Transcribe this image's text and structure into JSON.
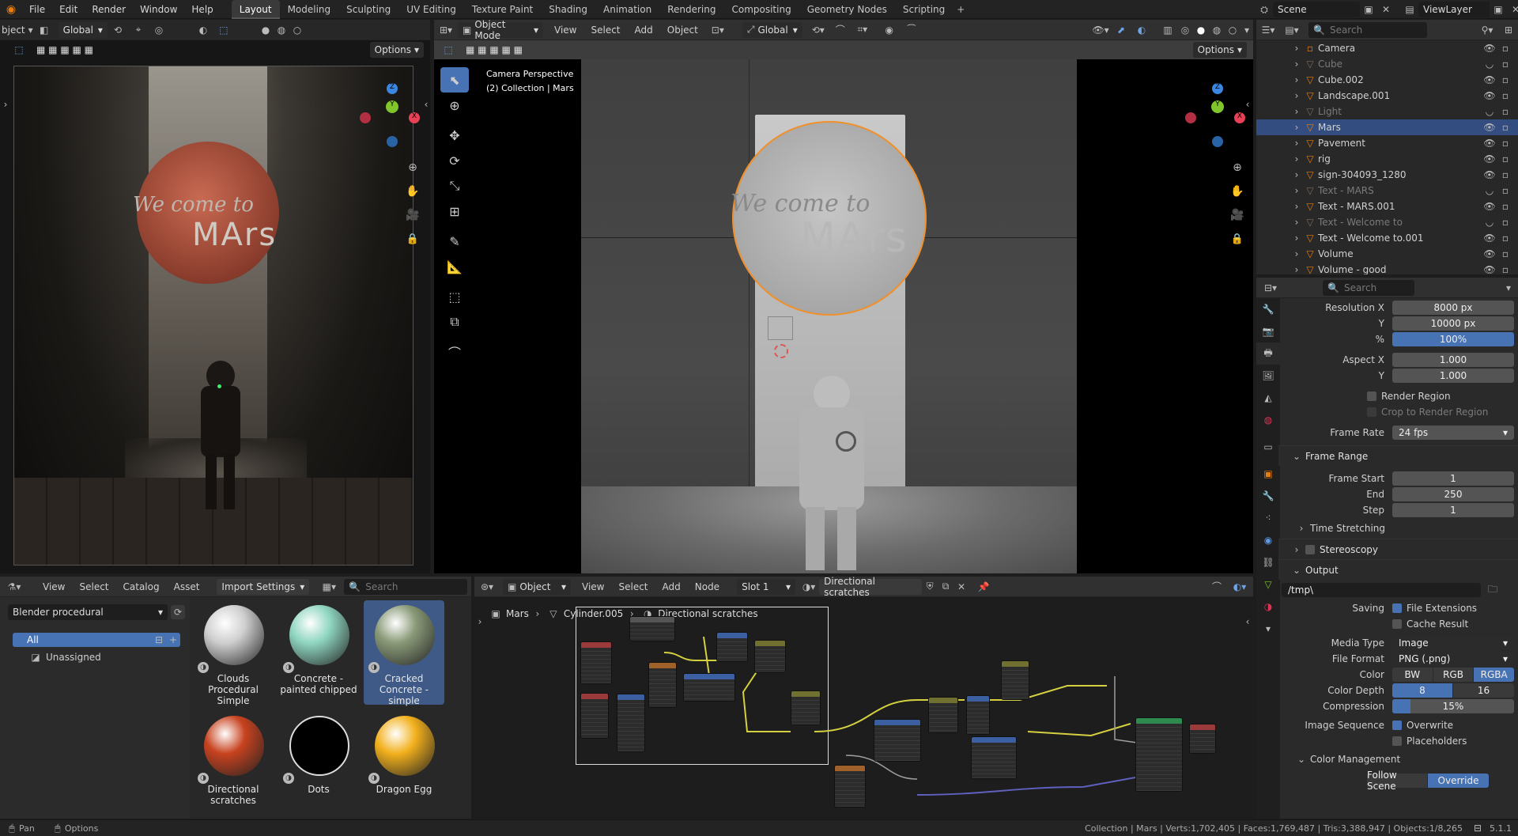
{
  "topbar": {
    "menus": [
      "File",
      "Edit",
      "Render",
      "Window",
      "Help"
    ],
    "workspaces": [
      "Layout",
      "Modeling",
      "Sculpting",
      "UV Editing",
      "Texture Paint",
      "Shading",
      "Animation",
      "Rendering",
      "Compositing",
      "Geometry Nodes",
      "Scripting"
    ],
    "active_workspace": "Layout",
    "scene": "Scene",
    "view_layer": "ViewLayer"
  },
  "left_viewport": {
    "mode_label": "bject",
    "transform": "Global",
    "options": "Options",
    "render_text_1": "We come to",
    "render_text_2": "MArs"
  },
  "main_viewport": {
    "mode": "Object Mode",
    "menus": [
      "View",
      "Select",
      "Add",
      "Object"
    ],
    "transform": "Global",
    "options": "Options",
    "info_line1": "Camera Perspective",
    "info_line2": "(2) Collection | Mars",
    "sign_text_1": "We come to",
    "sign_text_2": "MArs"
  },
  "asset_browser": {
    "menus": [
      "View",
      "Select",
      "Catalog",
      "Asset"
    ],
    "import_settings": "Import Settings",
    "search_placeholder": "Search",
    "library": "Blender procedural",
    "catalog_all": "All",
    "catalog_unassigned": "Unassigned",
    "assets": [
      {
        "name": "Clouds Procedural Simple",
        "color": "#cfcfcf"
      },
      {
        "name": "Concrete - painted chipped",
        "color": "#8fd6c0"
      },
      {
        "name": "Cracked Concrete - simple",
        "color": "#8a9a78"
      },
      {
        "name": "Directional scratches",
        "color": "#c8421f"
      },
      {
        "name": "Dots",
        "color": "#000000"
      },
      {
        "name": "Dragon Egg",
        "color": "#f2b01c"
      }
    ]
  },
  "node_editor": {
    "type": "Object",
    "menus": [
      "View",
      "Select",
      "Add",
      "Node"
    ],
    "slot": "Slot 1",
    "material": "Directional scratches",
    "breadcrumb": [
      "Mars",
      "Cylinder.005",
      "Directional scratches"
    ]
  },
  "outliner": {
    "search_placeholder": "Search",
    "items": [
      {
        "name": "Camera",
        "icon": "camera",
        "dim": false,
        "sel": false
      },
      {
        "name": "Cube",
        "icon": "mesh",
        "dim": true,
        "sel": false
      },
      {
        "name": "Cube.002",
        "icon": "mesh",
        "dim": false,
        "sel": false
      },
      {
        "name": "Landscape.001",
        "icon": "mesh",
        "dim": false,
        "sel": false
      },
      {
        "name": "Light",
        "icon": "light",
        "dim": true,
        "sel": false
      },
      {
        "name": "Mars",
        "icon": "mesh",
        "dim": false,
        "sel": true
      },
      {
        "name": "Pavement",
        "icon": "mesh",
        "dim": false,
        "sel": false
      },
      {
        "name": "rig",
        "icon": "armature",
        "dim": false,
        "sel": false
      },
      {
        "name": "sign-304093_1280",
        "icon": "mesh",
        "dim": false,
        "sel": false
      },
      {
        "name": "Text - MARS",
        "icon": "text",
        "dim": true,
        "sel": false
      },
      {
        "name": "Text - MARS.001",
        "icon": "mesh",
        "dim": false,
        "sel": false
      },
      {
        "name": "Text - Welcome to",
        "icon": "text",
        "dim": true,
        "sel": false
      },
      {
        "name": "Text - Welcome to.001",
        "icon": "mesh",
        "dim": false,
        "sel": false
      },
      {
        "name": "Volume",
        "icon": "mesh",
        "dim": false,
        "sel": false
      },
      {
        "name": "Volume - good",
        "icon": "mesh",
        "dim": false,
        "sel": false
      }
    ]
  },
  "properties": {
    "search_placeholder": "Search",
    "resolution_x_label": "Resolution X",
    "resolution_x": "8000 px",
    "resolution_y_label": "Y",
    "resolution_y": "10000 px",
    "percent_label": "%",
    "percent": "100%",
    "aspect_x_label": "Aspect X",
    "aspect_x": "1.000",
    "aspect_y_label": "Y",
    "aspect_y": "1.000",
    "render_region": "Render Region",
    "crop_region": "Crop to Render Region",
    "frame_rate_label": "Frame Rate",
    "frame_rate": "24 fps",
    "frame_range": "Frame Range",
    "frame_start_label": "Frame Start",
    "frame_start": "1",
    "end_label": "End",
    "end": "250",
    "step_label": "Step",
    "step": "1",
    "time_stretching": "Time Stretching",
    "stereoscopy": "Stereoscopy",
    "output": "Output",
    "output_path": "/tmp\\",
    "saving_label": "Saving",
    "file_extensions": "File Extensions",
    "cache_result": "Cache Result",
    "media_type_label": "Media Type",
    "media_type": "Image",
    "file_format_label": "File Format",
    "file_format": "PNG (.png)",
    "color_label": "Color",
    "color_bw": "BW",
    "color_rgb": "RGB",
    "color_rgba": "RGBA",
    "color_depth_label": "Color Depth",
    "depth_8": "8",
    "depth_16": "16",
    "compression_label": "Compression",
    "compression": "15%",
    "image_sequence_label": "Image Sequence",
    "overwrite": "Overwrite",
    "placeholders": "Placeholders",
    "color_management": "Color Management",
    "follow_scene": "Follow Scene",
    "override": "Override"
  },
  "statusbar": {
    "pan": "Pan",
    "options": "Options",
    "stats": "Collection | Mars | Verts:1,702,405 | Faces:1,769,487 | Tris:3,388,947 | Objects:1/8,265",
    "version": "5.1.1"
  },
  "colors": {
    "accent": "#4772b3",
    "selection_orange": "#f0902a",
    "x_axis": "#e84057",
    "y_axis": "#7fc52b",
    "z_axis": "#3b86e0"
  }
}
